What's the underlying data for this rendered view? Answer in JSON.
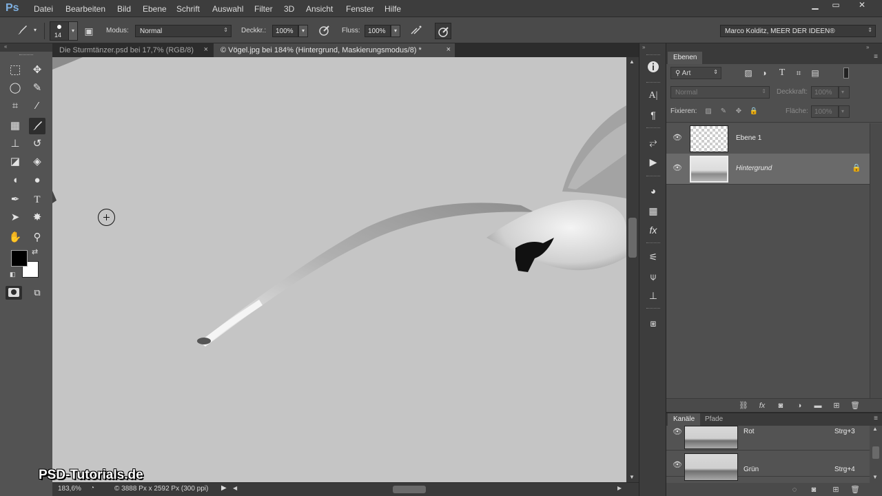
{
  "app": {
    "logo": "Ps",
    "menu": [
      "Datei",
      "Bearbeiten",
      "Bild",
      "Ebene",
      "Schrift",
      "Auswahl",
      "Filter",
      "3D",
      "Ansicht",
      "Fenster",
      "Hilfe"
    ],
    "window_controls": {
      "minimize": "▁",
      "maximize": "▭",
      "close": "✕"
    }
  },
  "options_bar": {
    "brush_size": "14",
    "mode_label": "Modus:",
    "mode_value": "Normal",
    "opacity_label": "Deckkr.:",
    "opacity_value": "100%",
    "flow_label": "Fluss:",
    "flow_value": "100%",
    "workspace": "Marco Kolditz, MEER DER IDEEN®"
  },
  "documents": {
    "tabs": [
      {
        "label": "Die Sturmtänzer.psd bei 17,7% (RGB/8)",
        "close": "×",
        "active": false
      },
      {
        "label": "© Vögel.jpg bei 184% (Hintergrund, Maskierungsmodus/8) *",
        "close": "×",
        "active": true
      }
    ]
  },
  "status": {
    "zoom": "183,6%",
    "doc_info": "© 3888 Px x 2592 Px (300 ppi)"
  },
  "watermark": "PSD-Tutorials.de",
  "layers_panel": {
    "tab": "Ebenen",
    "filter_kind": "Art",
    "blend_mode": "Normal",
    "opacity_label": "Deckkraft:",
    "opacity_value": "100%",
    "lock_label": "Fixieren:",
    "fill_label": "Fläche:",
    "fill_value": "100%",
    "layers": [
      {
        "name": "Ebene 1",
        "visible": true,
        "selected": false
      },
      {
        "name": "Hintergrund",
        "visible": true,
        "selected": true,
        "locked": true
      }
    ]
  },
  "channels_panel": {
    "tabs": [
      "Kanäle",
      "Pfade"
    ],
    "channels": [
      {
        "name": "Rot",
        "shortcut": "Strg+3"
      },
      {
        "name": "Grün",
        "shortcut": "Strg+4"
      }
    ]
  },
  "colors": {
    "foreground": "#000000",
    "background": "#ffffff",
    "accent": "#7fb0e0"
  }
}
